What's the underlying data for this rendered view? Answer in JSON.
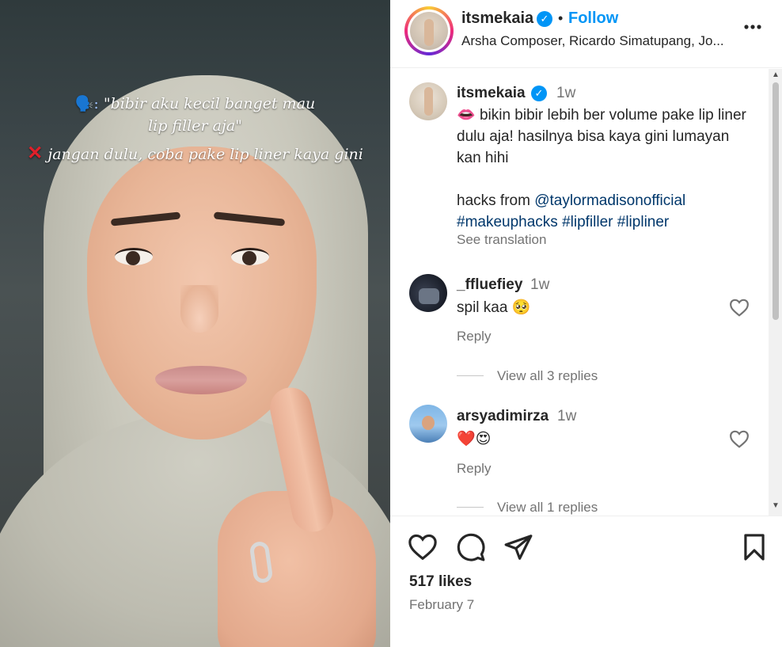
{
  "media": {
    "caption_line1": "\"bibir aku kecil banget mau",
    "caption_line2": "lip filler aja\"",
    "caption_line3": "jangan dulu, coba pake lip liner kaya gini",
    "caption_icon1": "speaking-head-icon",
    "caption_icon2": "cross-mark-icon"
  },
  "header": {
    "username": "itsmekaia",
    "separator": "•",
    "follow_label": "Follow",
    "subtitle": "Arsha Composer, Ricardo Simatupang, Jo...",
    "more_label": "•••"
  },
  "post_caption": {
    "username": "itsmekaia",
    "time": "1w",
    "lips_emoji": "👄",
    "text_main": " bikin bibir lebih ber volume pake lip liner dulu aja! hasilnya bisa kaya gini lumayan kan hihi",
    "hacks_prefix": "hacks from ",
    "mention": "@taylormadisonofficial",
    "hashtags": "#makeuphacks #lipfiller #lipliner",
    "see_translation": "See translation"
  },
  "comments": [
    {
      "username": "_ffluefiey",
      "time": "1w",
      "text": "spil kaa",
      "emoji": "🥺",
      "reply_label": "Reply",
      "view_replies": "View all 3 replies"
    },
    {
      "username": "arsyadimirza",
      "time": "1w",
      "text": "",
      "emoji": "❤️😍",
      "reply_label": "Reply",
      "view_replies": "View all 1 replies"
    }
  ],
  "footer": {
    "likes": "517 likes",
    "date": "February 7"
  },
  "colors": {
    "accent": "#0095f6",
    "link": "#00376b",
    "secondary_text": "#737373",
    "primary_text": "#262626"
  }
}
